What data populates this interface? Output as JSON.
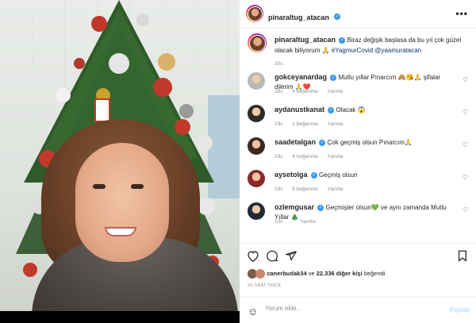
{
  "post": {
    "author": "pinaraltug_atacan",
    "caption_main": "Biraz değişik başlasa da bu yıl çok güzel olacak biliyorum 🙏 ",
    "caption_tags": "#YagmurCovid @yaamuratacan",
    "caption_time": "20s"
  },
  "comments": [
    {
      "user": "gokceyanardag",
      "text": "Mutlu yıllar Pınarcım 🙈😘🙏 şifalar dilerim 🙏❤️",
      "time": "18s",
      "likes": "4 beğenme",
      "reply": "Yanıtla"
    },
    {
      "user": "aydanustkanat",
      "text": "Olacak 😱",
      "time": "19s",
      "likes": "2 beğenme",
      "reply": "Yanıtla"
    },
    {
      "user": "saadetalgan",
      "text": "Çok geçmiş olsun Pınarcım🙏",
      "time": "19s",
      "likes": "4 beğenme",
      "reply": "Yanıtla"
    },
    {
      "user": "aysetolga",
      "text": "Geçmiş olsun",
      "time": "19s",
      "likes": "8 beğenme",
      "reply": "Yanıtla"
    },
    {
      "user": "ozlemgusar",
      "text": "Geçmişler olsun💚 ve aynı zamanda Mutlu Yıllar 🎄",
      "time": "10s",
      "likes": "",
      "reply": "Yanıtla"
    }
  ],
  "likes": {
    "first_user": "canerbudak34",
    "connector": " ve ",
    "others": "22.336 diğer kişi",
    "suffix": " beğendi"
  },
  "timestamp": "20 SAAT ÖNCE",
  "add_comment": {
    "placeholder": "Yorum ekle...",
    "share_label": "Paylaş"
  },
  "icons": {
    "more": "more-icon",
    "heart": "heart-icon",
    "comment": "comment-icon",
    "share": "share-icon",
    "bookmark": "bookmark-icon",
    "emoji": "emoji-icon"
  },
  "colors": {
    "verified": "#3897f0",
    "link": "#00376b",
    "muted": "#8e8e8e",
    "share_disabled": "#b3dbff"
  }
}
